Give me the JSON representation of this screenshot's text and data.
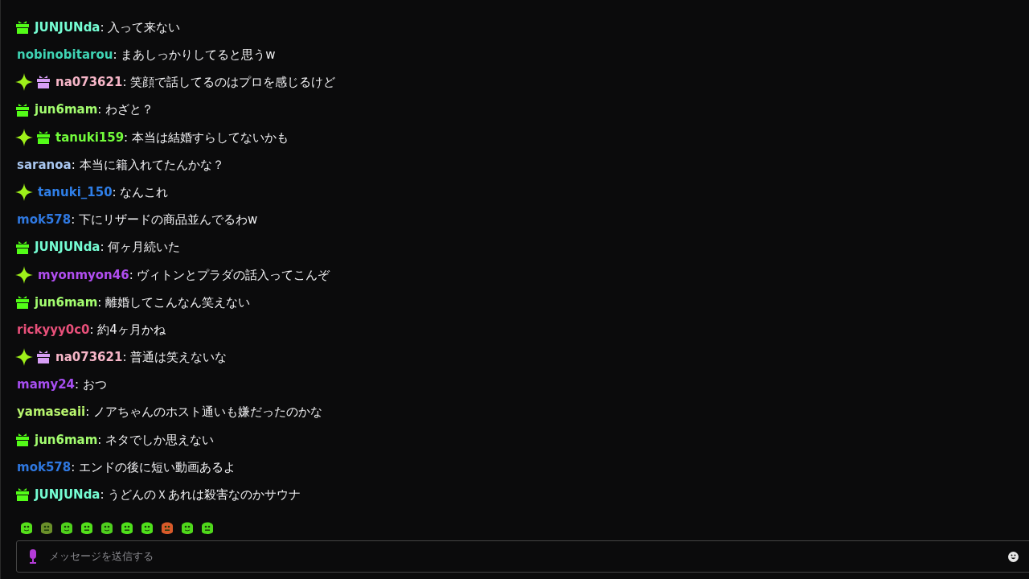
{
  "messages": [
    {
      "badges": [
        {
          "kind": "gift",
          "color": "#53fc18"
        }
      ],
      "user": "JUNJUNda",
      "color": "#75fdd3",
      "text": ": 入って来ない"
    },
    {
      "user": "nobinobitarou",
      "color": "#3fd4b4",
      "text": ": まあしっかりしてると思うw"
    },
    {
      "badges": [
        {
          "kind": "sparkle"
        },
        {
          "kind": "gift",
          "color": "#d79ef5"
        }
      ],
      "user": "na073621",
      "color": "#f7b6c8",
      "text": ": 笑顔で話してるのはプロを感じるけど"
    },
    {
      "badges": [
        {
          "kind": "gift",
          "color": "#53fc18"
        }
      ],
      "user": "jun6mam",
      "color": "#a3fd6f",
      "text": ": わざと？"
    },
    {
      "badges": [
        {
          "kind": "sparkle"
        },
        {
          "kind": "gift",
          "color": "#53fc18"
        }
      ],
      "user": "tanuki159",
      "color": "#72fc3b",
      "text": ": 本当は結婚すらしてないかも"
    },
    {
      "user": "saranoa",
      "color": "#a9c7f0",
      "text": ": 本当に籍入れてたんかな？"
    },
    {
      "badges": [
        {
          "kind": "sparkle"
        }
      ],
      "user": "tanuki_150",
      "color": "#2f7fe8",
      "text": ": なんこれ"
    },
    {
      "user": "mok578",
      "color": "#2f78e0",
      "text": ": 下にリザードの商品並んでるわw"
    },
    {
      "badges": [
        {
          "kind": "gift",
          "color": "#53fc18"
        }
      ],
      "user": "JUNJUNda",
      "color": "#75fdd3",
      "text": ": 何ヶ月続いた"
    },
    {
      "badges": [
        {
          "kind": "sparkle"
        }
      ],
      "user": "myonmyon46",
      "color": "#b04ef0",
      "text": ": ヴィトンとプラダの話入ってこんぞ"
    },
    {
      "badges": [
        {
          "kind": "gift",
          "color": "#53fc18"
        }
      ],
      "user": "jun6mam",
      "color": "#a3fd6f",
      "text": ": 離婚してこんなん笑えない"
    },
    {
      "user": "rickyyy0c0",
      "color": "#e8507a",
      "text": ": 約4ヶ月かね"
    },
    {
      "badges": [
        {
          "kind": "sparkle"
        },
        {
          "kind": "gift",
          "color": "#d79ef5"
        }
      ],
      "user": "na073621",
      "color": "#f7b6c8",
      "text": ": 普通は笑えないな"
    },
    {
      "user": "mamy24",
      "color": "#a64ef0",
      "text": ": おつ"
    },
    {
      "user": "yamaseaii",
      "color": "#b8f56e",
      "text": ": ノアちゃんのホスト通いも嫌だったのかな"
    },
    {
      "badges": [
        {
          "kind": "gift",
          "color": "#53fc18"
        }
      ],
      "user": "jun6mam",
      "color": "#a3fd6f",
      "text": ": ネタでしか思えない"
    },
    {
      "user": "mok578",
      "color": "#2f78e0",
      "text": ": エンドの後に短い動画あるよ"
    },
    {
      "badges": [
        {
          "kind": "gift",
          "color": "#53fc18"
        }
      ],
      "user": "JUNJUNda",
      "color": "#75fdd3",
      "text": ": うどんのＸあれは殺害なのかサウナ"
    }
  ],
  "composer": {
    "placeholder": "メッセージを送信する"
  }
}
